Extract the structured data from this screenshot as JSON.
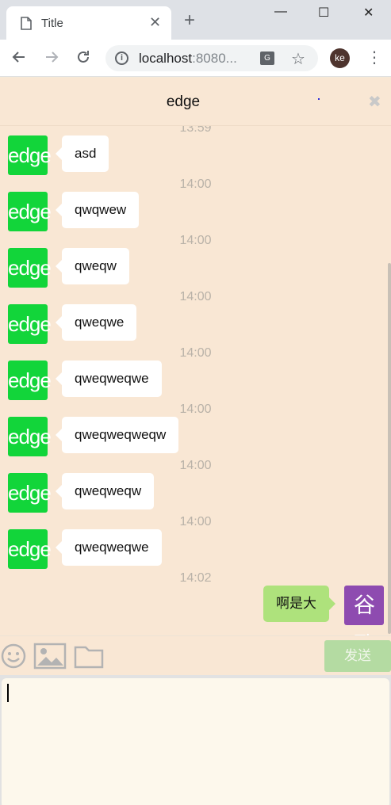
{
  "browser": {
    "tab_title": "Title",
    "tab_close": "✕",
    "new_tab": "+",
    "window_controls": {
      "minimize": "—",
      "maximize": "☐",
      "close": "✕"
    },
    "url_host": "localhost",
    "url_rest": ":8080...",
    "profile_initials": "ke",
    "translate_glyph": "G",
    "info_glyph": "i"
  },
  "chat": {
    "contact_name": "edge",
    "close_glyph": "✖",
    "avatar_edge": "edge",
    "avatar_me": "谷歌",
    "partial_timestamp": "13:59",
    "messages": [
      {
        "text": "asd",
        "time": "14:00"
      },
      {
        "text": "qwqwew",
        "time": "14:00"
      },
      {
        "text": "qweqw",
        "time": "14:00"
      },
      {
        "text": "qweqwe",
        "time": "14:00"
      },
      {
        "text": "qweqweqwe",
        "time": "14:00"
      },
      {
        "text": "qweqweqweqw",
        "time": "14:00"
      },
      {
        "text": "qweqweqw",
        "time": "14:00"
      },
      {
        "text": "qweqweqwe",
        "time": "14:02"
      }
    ],
    "my_message": "啊是大"
  },
  "composer": {
    "send_label": "发送",
    "input_value": ""
  },
  "colors": {
    "edge_avatar": "#12d53a",
    "me_avatar": "#8e4bb0",
    "my_bubble": "#aee27c",
    "background": "#f9e7d4",
    "send_button": "#b4dba2"
  }
}
